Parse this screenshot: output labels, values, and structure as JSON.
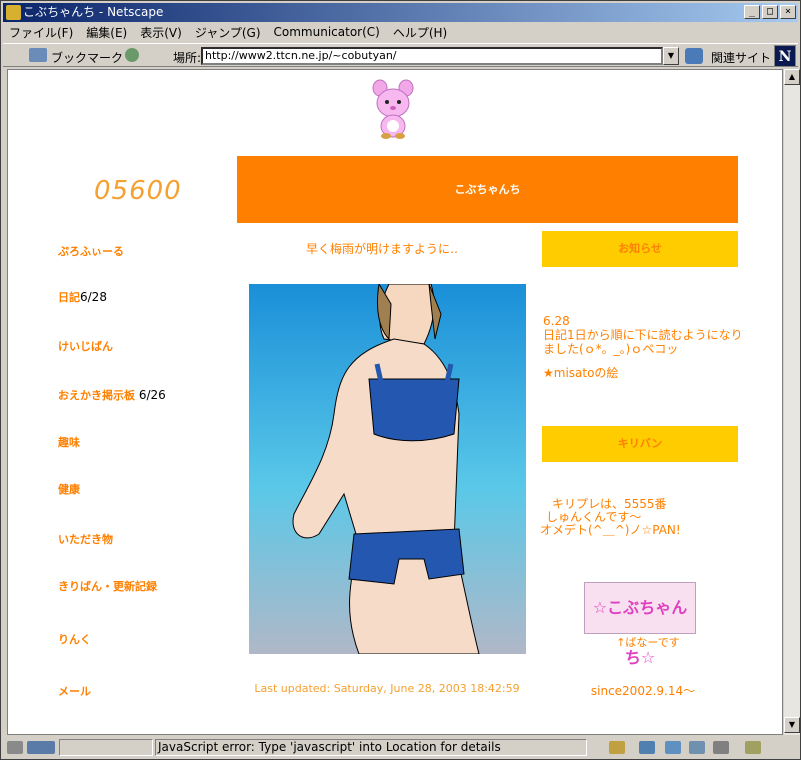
{
  "window": {
    "title": "こぶちゃんち - Netscape",
    "btn_min": "_",
    "btn_max": "□",
    "btn_close": "×"
  },
  "menu": [
    "ファイル(F)",
    "編集(E)",
    "表示(V)",
    "ジャンプ(G)",
    "Communicator(C)",
    "ヘルプ(H)"
  ],
  "toolbar": {
    "bookmarks_label": "ブックマーク",
    "location_label": "場所:",
    "url": "http://www2.ttcn.ne.jp/~cobutyan/",
    "related_label": "関連サイト",
    "logo": "N"
  },
  "page": {
    "counter": "05600",
    "site_title": "こぶちゃんち",
    "greeting": "早く梅雨が明けますように‥",
    "nav": [
      {
        "label": "ぷろふぃーる",
        "extra": ""
      },
      {
        "label": "日記",
        "extra": "6/28"
      },
      {
        "label": "けいじばん",
        "extra": ""
      },
      {
        "label": "おえかき掲示板",
        "extra": " 6/26"
      },
      {
        "label": "趣味",
        "extra": ""
      },
      {
        "label": "健康",
        "extra": ""
      },
      {
        "label": "いただき物",
        "extra": ""
      },
      {
        "label": "きりばん・更新記録",
        "extra": ""
      },
      {
        "label": "りんく",
        "extra": ""
      },
      {
        "label": "メール",
        "extra": ""
      }
    ],
    "notice_title": "お知らせ",
    "news_date": "6.28",
    "news_body": "日記1日から順に下に読むようになりました(ｏ*。_。)ｏペコッ",
    "news_link": "★misatoの絵",
    "kiriban_title": "キリバン",
    "kiriban_line1": "キリプレは、5555番",
    "kiriban_line2": "しゅんくんです～",
    "kiriban_line3": "オメデト(^＿^)ノ☆PAN!",
    "banner_text": "☆こぶちゃんち☆",
    "banner_caption": "↑ばなーです",
    "last_updated": "Last updated: Saturday, June 28, 2003 18:42:59",
    "since": "since2002.9.14～"
  },
  "status": {
    "message": "JavaScript error: Type 'javascript' into Location for details"
  },
  "colors": {
    "accent": "#ff8000",
    "highlight": "#ffcc00"
  }
}
